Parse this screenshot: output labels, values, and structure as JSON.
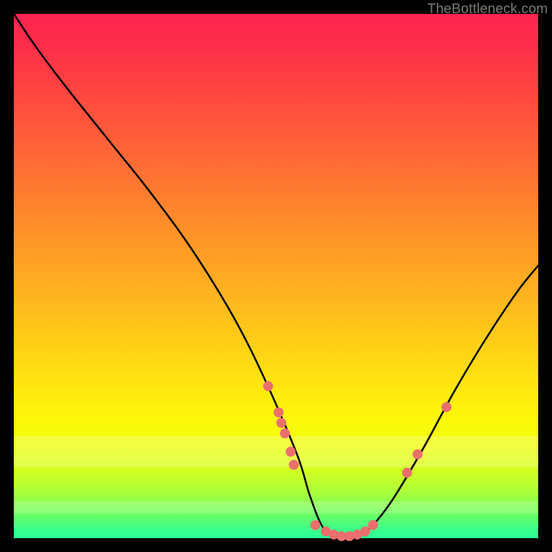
{
  "watermark": "TheBottleneck.com",
  "chart_data": {
    "type": "line",
    "title": "",
    "xlabel": "",
    "ylabel": "",
    "ylim": [
      0,
      100
    ],
    "series": [
      {
        "name": "bottleneck-curve",
        "x": [
          0,
          4,
          10,
          18,
          26,
          34,
          42,
          48,
          54,
          56.5,
          59,
          62,
          65,
          68,
          72,
          78,
          84,
          90,
          96,
          100
        ],
        "y": [
          100,
          94,
          86,
          76,
          66,
          55,
          42,
          30,
          16,
          8,
          2,
          0,
          0,
          2,
          7,
          17,
          28,
          38,
          47,
          52
        ],
        "note": "y is percentage of chart height from bottom; values estimated from pixels"
      }
    ],
    "markers": {
      "name": "highlight-dots",
      "color": "#ea6f6d",
      "points": [
        {
          "x": 48.5,
          "y": 29
        },
        {
          "x": 50.5,
          "y": 24
        },
        {
          "x": 51.0,
          "y": 22
        },
        {
          "x": 51.7,
          "y": 20
        },
        {
          "x": 52.8,
          "y": 16.5
        },
        {
          "x": 53.4,
          "y": 14
        },
        {
          "x": 57.5,
          "y": 2.5
        },
        {
          "x": 59.5,
          "y": 1.3
        },
        {
          "x": 61.0,
          "y": 0.7
        },
        {
          "x": 62.5,
          "y": 0.4
        },
        {
          "x": 64.0,
          "y": 0.4
        },
        {
          "x": 65.5,
          "y": 0.7
        },
        {
          "x": 67.0,
          "y": 1.3
        },
        {
          "x": 68.5,
          "y": 2.5
        },
        {
          "x": 75.0,
          "y": 12.5
        },
        {
          "x": 77.0,
          "y": 16
        },
        {
          "x": 82.5,
          "y": 25
        }
      ],
      "note": "x,y in percent of plot area; y measured from bottom"
    },
    "background_gradient": {
      "top": "#fe2450",
      "mid": "#ffd814",
      "bottom": "#28ff98"
    }
  }
}
